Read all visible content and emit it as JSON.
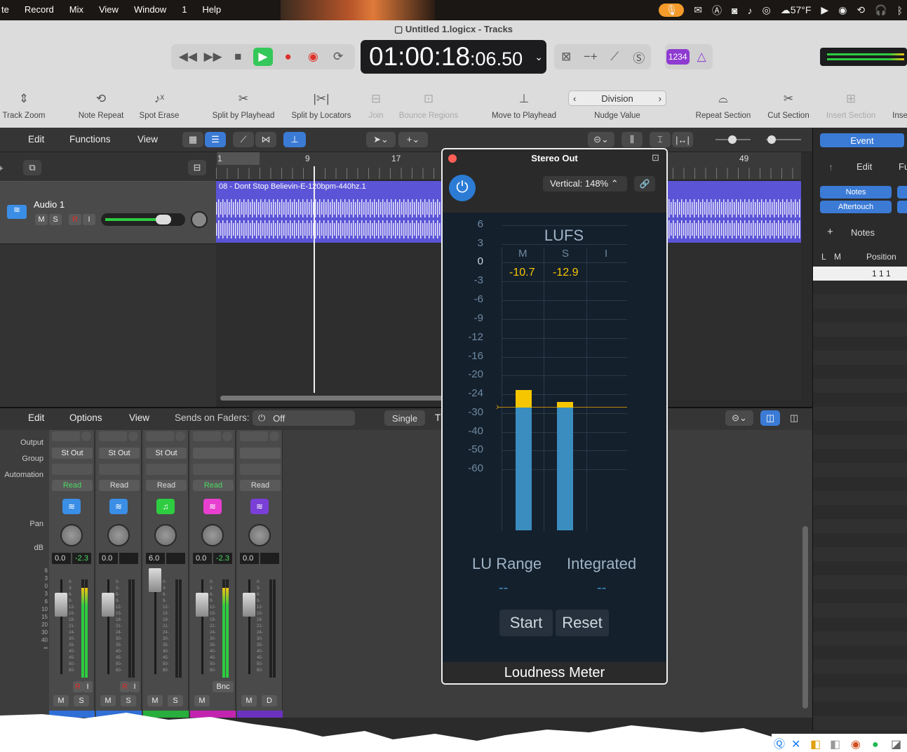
{
  "menubar": {
    "items": [
      "te",
      "Record",
      "Mix",
      "View",
      "Window",
      "1",
      "Help"
    ],
    "weather": "57°F"
  },
  "window": {
    "title": "Untitled 1.logicx - Tracks"
  },
  "lcd": {
    "time_main": "01:00:18",
    "time_sub": ":06.50"
  },
  "modes": {
    "count_in": "1234"
  },
  "toolbar": {
    "items": [
      {
        "label": "Track Zoom",
        "dim": false
      },
      {
        "label": "Note Repeat",
        "dim": false
      },
      {
        "label": "Spot Erase",
        "dim": false
      },
      {
        "label": "Split by Playhead",
        "dim": false
      },
      {
        "label": "Split by Locators",
        "dim": false
      },
      {
        "label": "Join",
        "dim": true
      },
      {
        "label": "Bounce Regions",
        "dim": true
      },
      {
        "label": "Move to Playhead",
        "dim": false
      },
      {
        "label": "Nudge Value",
        "dim": false
      },
      {
        "label": "Repeat Section",
        "dim": false
      },
      {
        "label": "Cut Section",
        "dim": false
      },
      {
        "label": "Insert Section",
        "dim": true
      },
      {
        "label": "Inse",
        "dim": false
      }
    ],
    "nudge_value": "Division"
  },
  "tracks_bar": {
    "edit": "Edit",
    "functions": "Functions",
    "view": "View"
  },
  "ruler": {
    "marks": [
      "1",
      "9",
      "17",
      "49"
    ]
  },
  "track": {
    "name": "Audio 1",
    "m": "M",
    "s": "S",
    "r": "R",
    "i": "I"
  },
  "region": {
    "name": "08 - Dont Stop Believin-E-120bpm-440hz.1"
  },
  "inspector": {
    "event": "Event",
    "edit": "Edit",
    "fu": "Fu",
    "notes_btn": "Notes",
    "aftertouch_btn": "Aftertouch",
    "notes_hdr": "Notes",
    "col_l": "L",
    "col_m": "M",
    "col_position": "Position",
    "position_val": "1 1 1"
  },
  "mixer_bar": {
    "edit": "Edit",
    "options": "Options",
    "view": "View",
    "sends_label": "Sends on Faders:",
    "sends_value": "Off",
    "single": "Single",
    "t": "T"
  },
  "mixer": {
    "row_labels": {
      "output": "Output",
      "group": "Group",
      "automation": "Automation",
      "pan": "Pan",
      "db": "dB"
    },
    "strips": [
      {
        "output": "St Out",
        "automation": "Read",
        "auto_color": "#4cd964",
        "icon_color": "#3b8ee6",
        "icon": "≋",
        "db_left": "0.0",
        "db_right": "-2.3",
        "rec": "R",
        "inp": "I",
        "m": "M",
        "s": "S",
        "color": "#2f6fd6"
      },
      {
        "output": "St Out",
        "automation": "Read",
        "auto_color": "#dddddd",
        "icon_color": "#3b8ee6",
        "icon": "≋",
        "db_left": "0.0",
        "db_right": "",
        "rec": "R",
        "inp": "I",
        "m": "M",
        "s": "S",
        "color": "#2f6fd6"
      },
      {
        "output": "St Out",
        "automation": "Read",
        "auto_color": "#dddddd",
        "icon_color": "#2ecc40",
        "icon": "♫",
        "db_left": "6.0",
        "db_right": "",
        "rec": "",
        "inp": "",
        "m": "M",
        "s": "S",
        "color": "#27ae3c"
      },
      {
        "output": "",
        "automation": "Read",
        "auto_color": "#4cd964",
        "icon_color": "#e83fd0",
        "icon": "≋",
        "db_left": "0.0",
        "db_right": "-2.3",
        "rec": "Bnc",
        "inp": "",
        "m": "M",
        "s": "",
        "color": "#c224b0"
      },
      {
        "output": "",
        "automation": "Read",
        "auto_color": "#dddddd",
        "icon_color": "#7a3fd6",
        "icon": "≋",
        "db_left": "0.0",
        "db_right": "",
        "rec": "",
        "inp": "",
        "m": "M",
        "s": "D",
        "color": "#6b32c0"
      }
    ],
    "fader_scale": [
      "6",
      "3",
      "0",
      "3",
      "6",
      "10",
      "15",
      "20",
      "30",
      "40",
      "∞"
    ]
  },
  "plugin": {
    "title": "Stereo Out",
    "vertical": "Vertical: 148%",
    "lufs": "LUFS",
    "col_m": "M",
    "col_s": "S",
    "col_i": "I",
    "m_value": "-10.7",
    "s_value": "-12.9",
    "ticks": [
      "6",
      "3",
      "0",
      "-3",
      "-6",
      "-9",
      "-12",
      "-16",
      "-20",
      "-24",
      "-30",
      "-40",
      "-50",
      "-60"
    ],
    "lu_range": "LU Range",
    "integrated": "Integrated",
    "lu_range_value": "--",
    "integrated_value": "--",
    "start": "Start",
    "reset": "Reset",
    "name": "Loudness Meter"
  }
}
